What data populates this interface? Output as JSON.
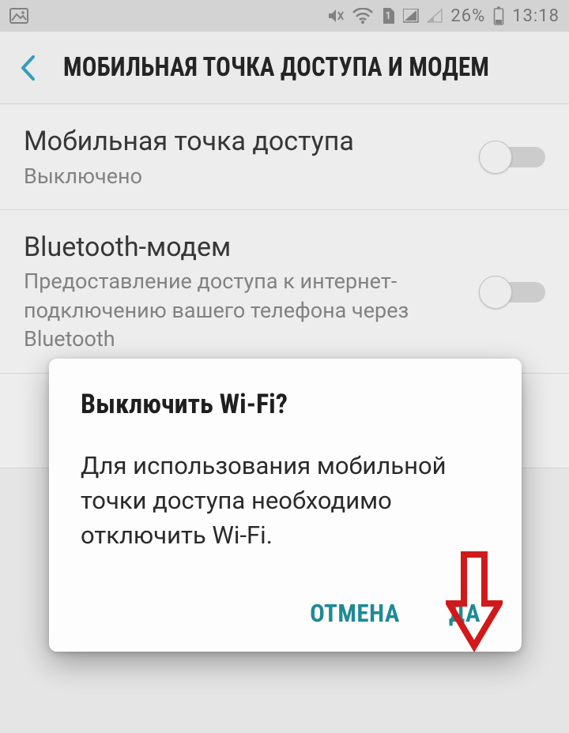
{
  "statusbar": {
    "battery": "26%",
    "clock": "13:18",
    "sim_badge": "1"
  },
  "appbar": {
    "title": "МОБИЛЬНАЯ ТОЧКА ДОСТУПА И МОДЕМ"
  },
  "settings": {
    "hotspot": {
      "label": "Мобильная точка доступа",
      "sub": "Выключено"
    },
    "bt": {
      "label": "Bluetooth-модем",
      "sub": "Предоставление доступа к интернет-подключению вашего телефона через Bluetooth"
    }
  },
  "dialog": {
    "title": "Выключить Wi-Fi?",
    "body": "Для использования мобильной точки доступа необходимо отключить Wi-Fi.",
    "cancel": "ОТМЕНА",
    "confirm": "ДА"
  }
}
